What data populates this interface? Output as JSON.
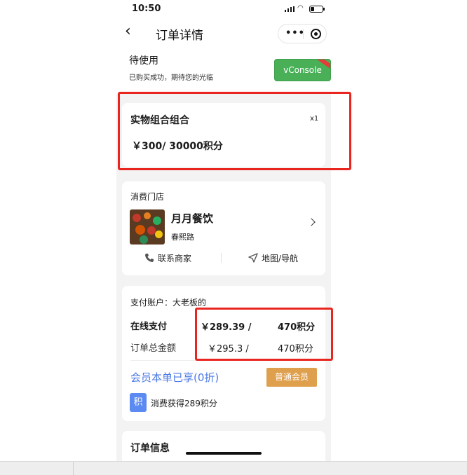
{
  "status_bar": {
    "time": "10:50"
  },
  "nav": {
    "title": "订单详情"
  },
  "order_status": {
    "title": "待使用",
    "subtitle": "已购买成功，期待您的光临",
    "vconsole_label": "vConsole"
  },
  "product": {
    "name": "实物组合组合",
    "quantity": "x1",
    "price": "￥300/ 30000积分"
  },
  "store": {
    "section_label": "消费门店",
    "name": "月月餐饮",
    "address": "春熙路",
    "contact_label": "联系商家",
    "map_label": "地图/导航"
  },
  "payment": {
    "account": "支付账户：大老板的",
    "rows": [
      {
        "label": "在线支付",
        "money": "￥289.39 /",
        "points": "470积分"
      },
      {
        "label": "订单总金额",
        "money": "￥295.3 /",
        "points": "470积分"
      }
    ],
    "member_text": "会员本单已享(0折)",
    "member_level": "普通会员",
    "points_icon": "积",
    "points_earned": "消费获得289积分"
  },
  "order_info": {
    "title": "订单信息"
  },
  "colors": {
    "highlight": "#e8261f",
    "accent_blue": "#4a79e6",
    "badge_gold": "#dfa04e",
    "vconsole_green": "#49b058"
  }
}
